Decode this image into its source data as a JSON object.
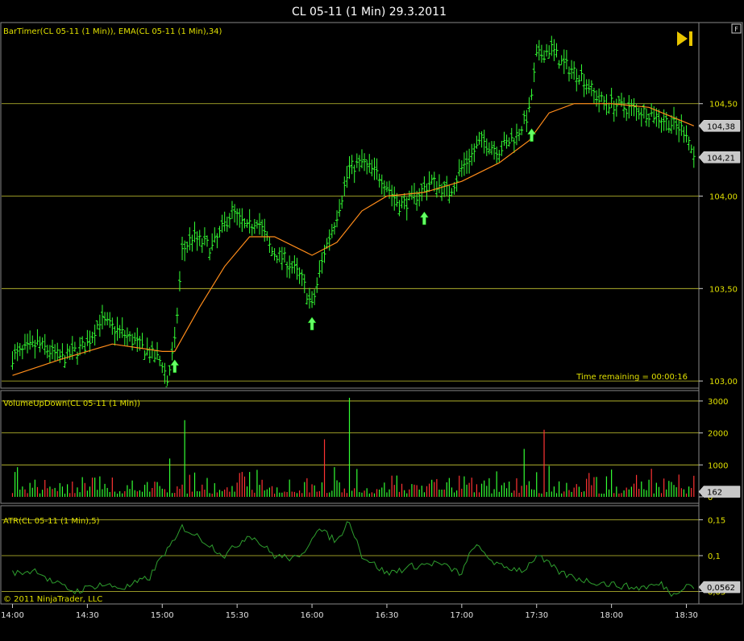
{
  "chart_data": [
    {
      "type": "line",
      "title": "CL 05-11 (1 Min)  29.3.2011",
      "indicator_label": "BarTimer(CL 05-11 (1 Min)), EMA(CL 05-11 (1 Min),34)",
      "time_remaining": "Time remaining = 00:00:16",
      "ylim": [
        102.97,
        104.93
      ],
      "yticks": [
        {
          "v": 103.0,
          "label": "103,00"
        },
        {
          "v": 103.5,
          "label": "103,50"
        },
        {
          "v": 104.0,
          "label": "104,00"
        },
        {
          "v": 104.5,
          "label": "104,50"
        }
      ],
      "last_price": {
        "v": 104.21,
        "label": "104,21"
      },
      "ema_value": {
        "v": 104.38,
        "label": "104,38"
      },
      "price_path": [
        [
          "14:00",
          103.13
        ],
        [
          "14:10",
          103.2
        ],
        [
          "14:20",
          103.12
        ],
        [
          "14:30",
          103.2
        ],
        [
          "14:35",
          103.33
        ],
        [
          "14:45",
          103.25
        ],
        [
          "14:55",
          103.15
        ],
        [
          "15:00",
          103.1
        ],
        [
          "15:02",
          103.0
        ],
        [
          "15:05",
          103.2
        ],
        [
          "15:08",
          103.7
        ],
        [
          "15:12",
          103.78
        ],
        [
          "15:20",
          103.72
        ],
        [
          "15:28",
          103.92
        ],
        [
          "15:34",
          103.82
        ],
        [
          "15:38",
          103.88
        ],
        [
          "15:44",
          103.7
        ],
        [
          "15:50",
          103.65
        ],
        [
          "15:56",
          103.55
        ],
        [
          "16:00",
          103.4
        ],
        [
          "16:05",
          103.7
        ],
        [
          "16:10",
          103.9
        ],
        [
          "16:15",
          104.15
        ],
        [
          "16:20",
          104.18
        ],
        [
          "16:28",
          104.1
        ],
        [
          "16:35",
          103.95
        ],
        [
          "16:40",
          103.98
        ],
        [
          "16:48",
          104.08
        ],
        [
          "16:55",
          104.02
        ],
        [
          "17:00",
          104.15
        ],
        [
          "17:08",
          104.3
        ],
        [
          "17:15",
          104.25
        ],
        [
          "17:22",
          104.33
        ],
        [
          "17:27",
          104.45
        ],
        [
          "17:30",
          104.75
        ],
        [
          "17:36",
          104.8
        ],
        [
          "17:40",
          104.72
        ],
        [
          "17:48",
          104.65
        ],
        [
          "17:55",
          104.52
        ],
        [
          "18:05",
          104.48
        ],
        [
          "18:15",
          104.45
        ],
        [
          "18:20",
          104.42
        ],
        [
          "18:30",
          104.35
        ],
        [
          "18:33",
          104.21
        ]
      ],
      "ema_path": [
        [
          "14:00",
          103.03
        ],
        [
          "14:20",
          103.12
        ],
        [
          "14:40",
          103.2
        ],
        [
          "15:00",
          103.16
        ],
        [
          "15:05",
          103.16
        ],
        [
          "15:15",
          103.4
        ],
        [
          "15:25",
          103.62
        ],
        [
          "15:35",
          103.78
        ],
        [
          "15:45",
          103.78
        ],
        [
          "16:00",
          103.68
        ],
        [
          "16:10",
          103.75
        ],
        [
          "16:20",
          103.92
        ],
        [
          "16:30",
          104.0
        ],
        [
          "16:45",
          104.02
        ],
        [
          "17:00",
          104.08
        ],
        [
          "17:15",
          104.18
        ],
        [
          "17:27",
          104.3
        ],
        [
          "17:35",
          104.45
        ],
        [
          "17:45",
          104.5
        ],
        [
          "18:00",
          104.5
        ],
        [
          "18:15",
          104.48
        ],
        [
          "18:33",
          104.38
        ]
      ],
      "signal_arrows": [
        [
          "15:05",
          103.15
        ],
        [
          "16:00",
          103.38
        ],
        [
          "16:45",
          103.95
        ],
        [
          "17:28",
          104.4
        ]
      ]
    },
    {
      "type": "bar",
      "indicator_label": "VolumeUpDown(CL 05-11 (1 Min))",
      "ylim": [
        0,
        3200
      ],
      "yticks": [
        {
          "v": 0,
          "label": "0"
        },
        {
          "v": 1000,
          "label": "1000"
        },
        {
          "v": 2000,
          "label": "2000"
        },
        {
          "v": 3000,
          "label": "3000"
        }
      ],
      "last_value": {
        "v": 162,
        "label": "162"
      },
      "spikes": [
        [
          "15:09",
          2400,
          "up"
        ],
        [
          "16:05",
          1800,
          "down"
        ],
        [
          "16:15",
          3100,
          "up"
        ],
        [
          "17:25",
          1500,
          "up"
        ],
        [
          "17:33",
          2100,
          "down"
        ],
        [
          "15:03",
          1200,
          "up"
        ]
      ]
    },
    {
      "type": "line",
      "indicator_label": "ATR(CL 05-11 (1 Min),5)",
      "ylim": [
        0.035,
        0.165
      ],
      "yticks": [
        {
          "v": 0.05,
          "label": "0,05"
        },
        {
          "v": 0.1,
          "label": "0,1"
        },
        {
          "v": 0.15,
          "label": "0,15"
        }
      ],
      "last_value": {
        "v": 0.0562,
        "label": "0,0562"
      },
      "path": [
        [
          "14:00",
          0.075
        ],
        [
          "14:10",
          0.08
        ],
        [
          "14:15",
          0.065
        ],
        [
          "14:25",
          0.05
        ],
        [
          "14:35",
          0.06
        ],
        [
          "14:45",
          0.055
        ],
        [
          "14:55",
          0.07
        ],
        [
          "15:00",
          0.1
        ],
        [
          "15:05",
          0.12
        ],
        [
          "15:08",
          0.14
        ],
        [
          "15:15",
          0.125
        ],
        [
          "15:25",
          0.1
        ],
        [
          "15:35",
          0.13
        ],
        [
          "15:45",
          0.1
        ],
        [
          "15:55",
          0.095
        ],
        [
          "16:02",
          0.138
        ],
        [
          "16:10",
          0.12
        ],
        [
          "16:15",
          0.15
        ],
        [
          "16:20",
          0.1
        ],
        [
          "16:30",
          0.075
        ],
        [
          "16:40",
          0.085
        ],
        [
          "16:50",
          0.09
        ],
        [
          "17:00",
          0.075
        ],
        [
          "17:05",
          0.115
        ],
        [
          "17:15",
          0.085
        ],
        [
          "17:25",
          0.08
        ],
        [
          "17:30",
          0.1
        ],
        [
          "17:40",
          0.075
        ],
        [
          "17:50",
          0.065
        ],
        [
          "18:00",
          0.06
        ],
        [
          "18:10",
          0.055
        ],
        [
          "18:20",
          0.06
        ],
        [
          "18:25",
          0.045
        ],
        [
          "18:30",
          0.062
        ],
        [
          "18:33",
          0.056
        ]
      ]
    }
  ],
  "time_axis": {
    "start": "13:55",
    "end": "18:35",
    "ticks": [
      "14:00",
      "14:30",
      "15:00",
      "15:30",
      "16:00",
      "16:30",
      "17:00",
      "17:30",
      "18:00",
      "18:30"
    ]
  },
  "copyright": "© 2011 NinjaTrader, LLC",
  "corner_label": "F",
  "colors": {
    "background": "#000000",
    "bar_up": "#33ff33",
    "bar_down": "#ff3333",
    "ema": "#ff8c1a",
    "gridline": "#c8c832",
    "axis_text": "#e0e000",
    "atr": "#2e9e2e",
    "arrow": "#66ff66"
  }
}
